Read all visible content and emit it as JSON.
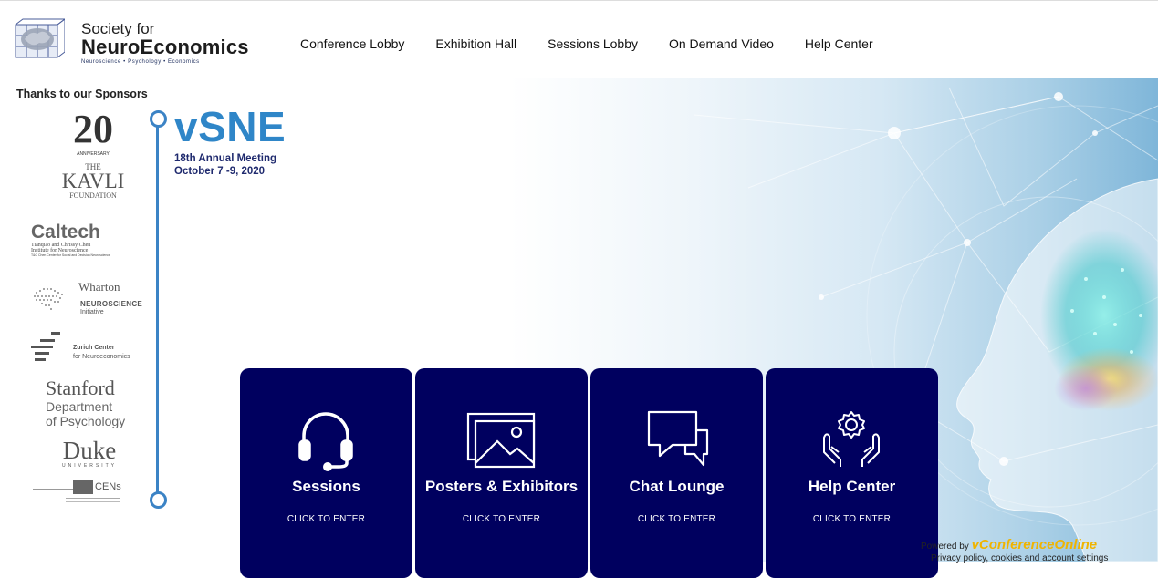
{
  "logo": {
    "line1": "Society for",
    "line2": "NeuroEconomics",
    "tagline": "Neuroscience • Psychology • Economics"
  },
  "nav": {
    "items": [
      {
        "label": "Conference Lobby"
      },
      {
        "label": "Exhibition Hall"
      },
      {
        "label": "Sessions Lobby"
      },
      {
        "label": "On Demand Video"
      },
      {
        "label": "Help Center"
      }
    ]
  },
  "sponsors": {
    "title": "Thanks to our Sponsors",
    "kavli_anniv": "ANNIVERSARY",
    "kavli_the": "THE",
    "kavli_name": "KAVLI",
    "kavli_foundation": "FOUNDATION",
    "caltech_name": "Caltech",
    "caltech_line1": "Tianqiao and Chrissy Chen",
    "caltech_line2": "Institute for Neuroscience",
    "caltech_line3": "T&C Chen Center for Social and Decision Neuroscience",
    "wharton_name": "Wharton",
    "wharton_line1": "NEUROSCIENCE",
    "wharton_line2": "Initiative",
    "zurich_line1": "Zurich Center",
    "zurich_line2": "for Neuroeconomics",
    "stanford_name": "Stanford",
    "stanford_line1": "Department",
    "stanford_line2": "of Psychology",
    "duke_name": "Duke",
    "duke_sub": "UNIVERSITY",
    "cens_label": "CENs"
  },
  "event": {
    "title": "vSNE",
    "meeting": "18th Annual Meeting",
    "dates": "October 7 -9, 2020"
  },
  "cards": [
    {
      "title": "Sessions",
      "cta": "CLICK TO ENTER",
      "icon": "headset-icon"
    },
    {
      "title": "Posters & Exhibitors",
      "cta": "CLICK TO ENTER",
      "icon": "posters-icon"
    },
    {
      "title": "Chat Lounge",
      "cta": "CLICK TO ENTER",
      "icon": "chat-bubbles-icon"
    },
    {
      "title": "Help Center",
      "cta": "CLICK TO ENTER",
      "icon": "gear-hands-icon"
    }
  ],
  "footer": {
    "powered_by": "Powered by",
    "brand": "vConferenceOnline",
    "links": "Privacy policy, cookies and account settings"
  },
  "colors": {
    "card_bg": "#00005f",
    "accent_blue": "#2f86c8",
    "timeline": "#3b83c5",
    "brand_gold": "#f0b400"
  }
}
